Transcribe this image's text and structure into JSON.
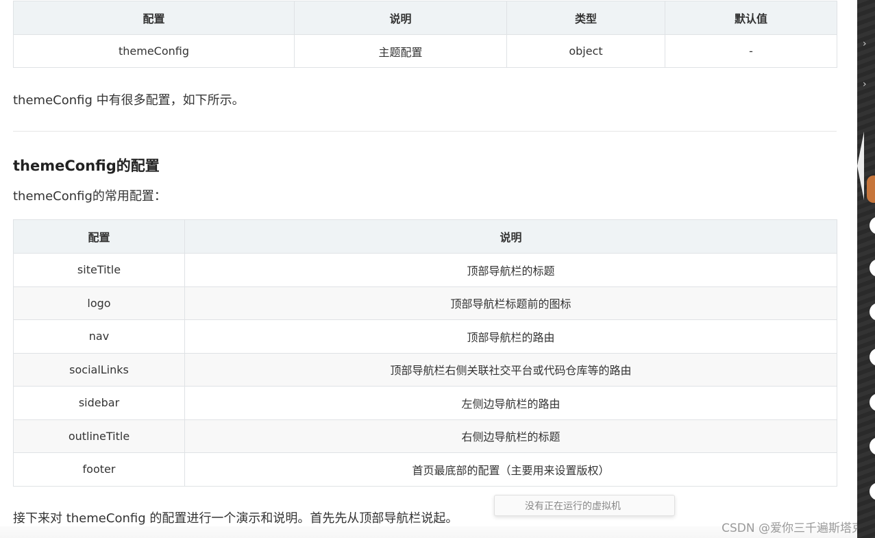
{
  "table1": {
    "headers": [
      "配置",
      "说明",
      "类型",
      "默认值"
    ],
    "rows": [
      [
        "themeConfig",
        "主题配置",
        "object",
        "-"
      ]
    ]
  },
  "intro_text": "themeConfig 中有很多配置，如下所示。",
  "section": {
    "heading": "themeConfig的配置",
    "subtitle": "themeConfig的常用配置："
  },
  "table2": {
    "headers": [
      "配置",
      "说明"
    ],
    "rows": [
      [
        "siteTitle",
        "顶部导航栏的标题"
      ],
      [
        "logo",
        "顶部导航栏标题前的图标"
      ],
      [
        "nav",
        "顶部导航栏的路由"
      ],
      [
        "socialLinks",
        "顶部导航栏右侧关联社交平台或代码仓库等的路由"
      ],
      [
        "sidebar",
        "左侧边导航栏的路由"
      ],
      [
        "outlineTitle",
        "右侧边导航栏的标题"
      ],
      [
        "footer",
        "首页最底部的配置（主要用来设置版权）"
      ]
    ]
  },
  "closing_text": "接下来对 themeConfig 的配置进行一个演示和说明。首先先从顶部导航栏说起。",
  "toast": {
    "message": "没有正在运行的虚拟机"
  },
  "watermark": "CSDN @爱你三千遍斯塔克",
  "right_strip": {
    "chevron_glyph": "›"
  }
}
